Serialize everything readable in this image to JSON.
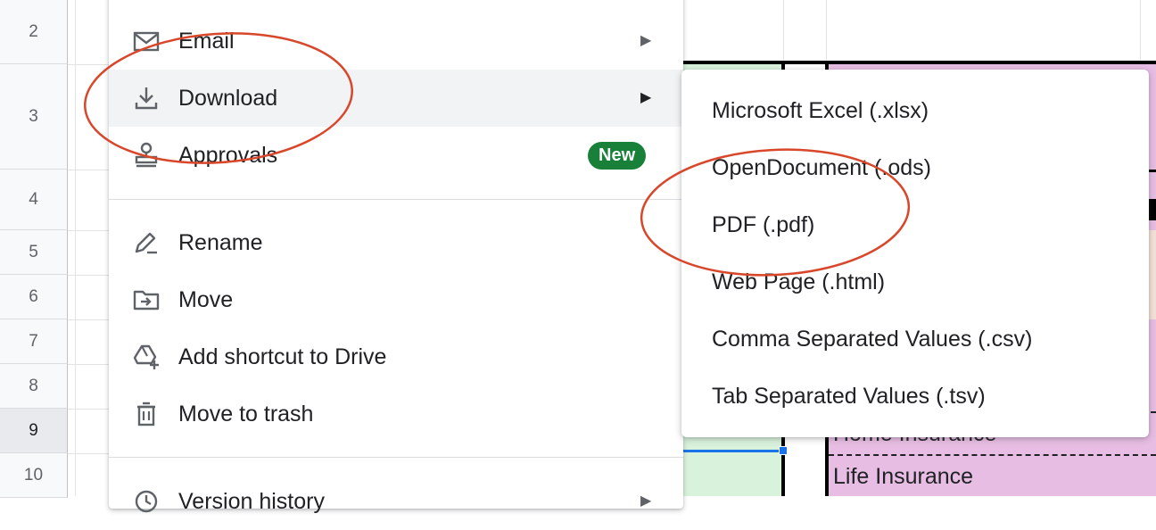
{
  "row_headers": [
    "2",
    "3",
    "4",
    "5",
    "6",
    "7",
    "8",
    "9",
    "10"
  ],
  "cells": {
    "home_insurance": "Home Insurance",
    "life_insurance": "Life Insurance"
  },
  "menu": {
    "items": [
      {
        "label": "Email"
      },
      {
        "label": "Download"
      },
      {
        "label": "Approvals",
        "badge": "New"
      },
      {
        "label": "Rename"
      },
      {
        "label": "Move"
      },
      {
        "label": "Add shortcut to Drive"
      },
      {
        "label": "Move to trash"
      },
      {
        "label": "Version history"
      }
    ]
  },
  "download_submenu": {
    "items": [
      {
        "label": "Microsoft Excel (.xlsx)"
      },
      {
        "label": "OpenDocument (.ods)"
      },
      {
        "label": "PDF (.pdf)"
      },
      {
        "label": "Web Page (.html)"
      },
      {
        "label": "Comma Separated Values (.csv)"
      },
      {
        "label": "Tab Separated Values (.tsv)"
      }
    ]
  },
  "colors": {
    "menu_highlight": "#f1f3f4",
    "badge_green": "#188038",
    "annotation_red": "#d9472b",
    "cell_green": "#d9f2dc",
    "cell_pink": "#e7bde3",
    "cell_peach": "#f3e2d8"
  }
}
